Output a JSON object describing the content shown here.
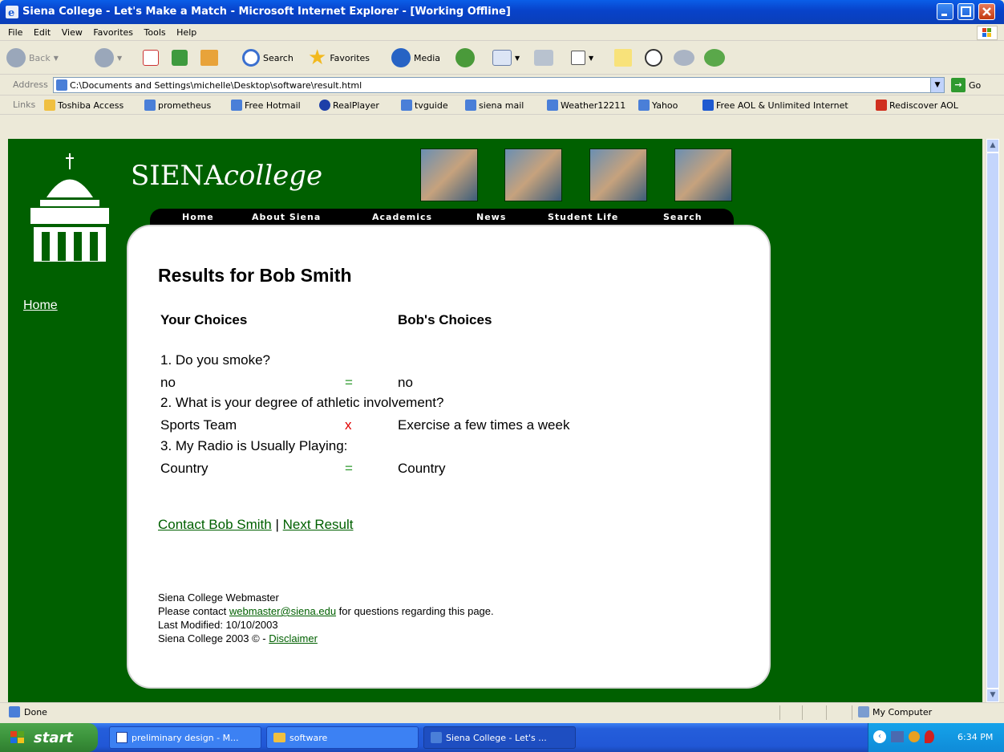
{
  "window": {
    "title": "Siena College - Let's Make a Match - Microsoft Internet Explorer - [Working Offline]"
  },
  "menu": [
    "File",
    "Edit",
    "View",
    "Favorites",
    "Tools",
    "Help"
  ],
  "toolbar": {
    "back": "Back",
    "search": "Search",
    "favorites": "Favorites",
    "media": "Media"
  },
  "address": {
    "label": "Address",
    "value": "C:\\Documents and Settings\\michelle\\Desktop\\software\\result.html",
    "go": "Go"
  },
  "links": {
    "label": "Links",
    "items": [
      "Toshiba Access",
      "prometheus",
      "Free Hotmail",
      "RealPlayer",
      "tvguide",
      "siena mail",
      "Weather12211",
      "Yahoo",
      "Free AOL & Unlimited Internet",
      "Rediscover AOL"
    ]
  },
  "site": {
    "brand_main": "SIENA",
    "brand_italic": "college",
    "nav": [
      "Home",
      "About Siena",
      "Academics",
      "News",
      "Student Life",
      "Search"
    ],
    "side_home": "Home"
  },
  "results": {
    "title": "Results for Bob Smith",
    "your_choices_header": "Your Choices",
    "bob_choices_header": "Bob's Choices",
    "questions": [
      {
        "question": "1. Do you smoke?",
        "yours": "no",
        "match": "=",
        "bobs": "no"
      },
      {
        "question": "2. What is your degree of athletic involvement?",
        "yours": "Sports Team",
        "match": "x",
        "bobs": "Exercise a few times a week"
      },
      {
        "question": "3. My Radio is Usually Playing:",
        "yours": "Country",
        "match": "=",
        "bobs": "Country"
      }
    ],
    "contact_link": "Contact Bob Smith",
    "separator": "|",
    "next_link": "Next Result"
  },
  "footer": {
    "line1": "Siena College Webmaster",
    "line2_prefix": "Please contact ",
    "email": "webmaster@siena.edu",
    "line2_suffix": " for questions regarding this page.",
    "line3": "Last Modified: 10/10/2003",
    "line4_prefix": "Siena College 2003 © - ",
    "disclaimer": "Disclaimer"
  },
  "status": {
    "text": "Done",
    "zone": "My Computer"
  },
  "taskbar": {
    "start": "start",
    "tasks": [
      "preliminary design - M...",
      "software",
      "Siena College - Let's ..."
    ],
    "clock": "6:34 PM"
  },
  "colors": {
    "page_green": "#006000",
    "match_equal": "#2e9a2e",
    "match_diff": "#e00000"
  }
}
